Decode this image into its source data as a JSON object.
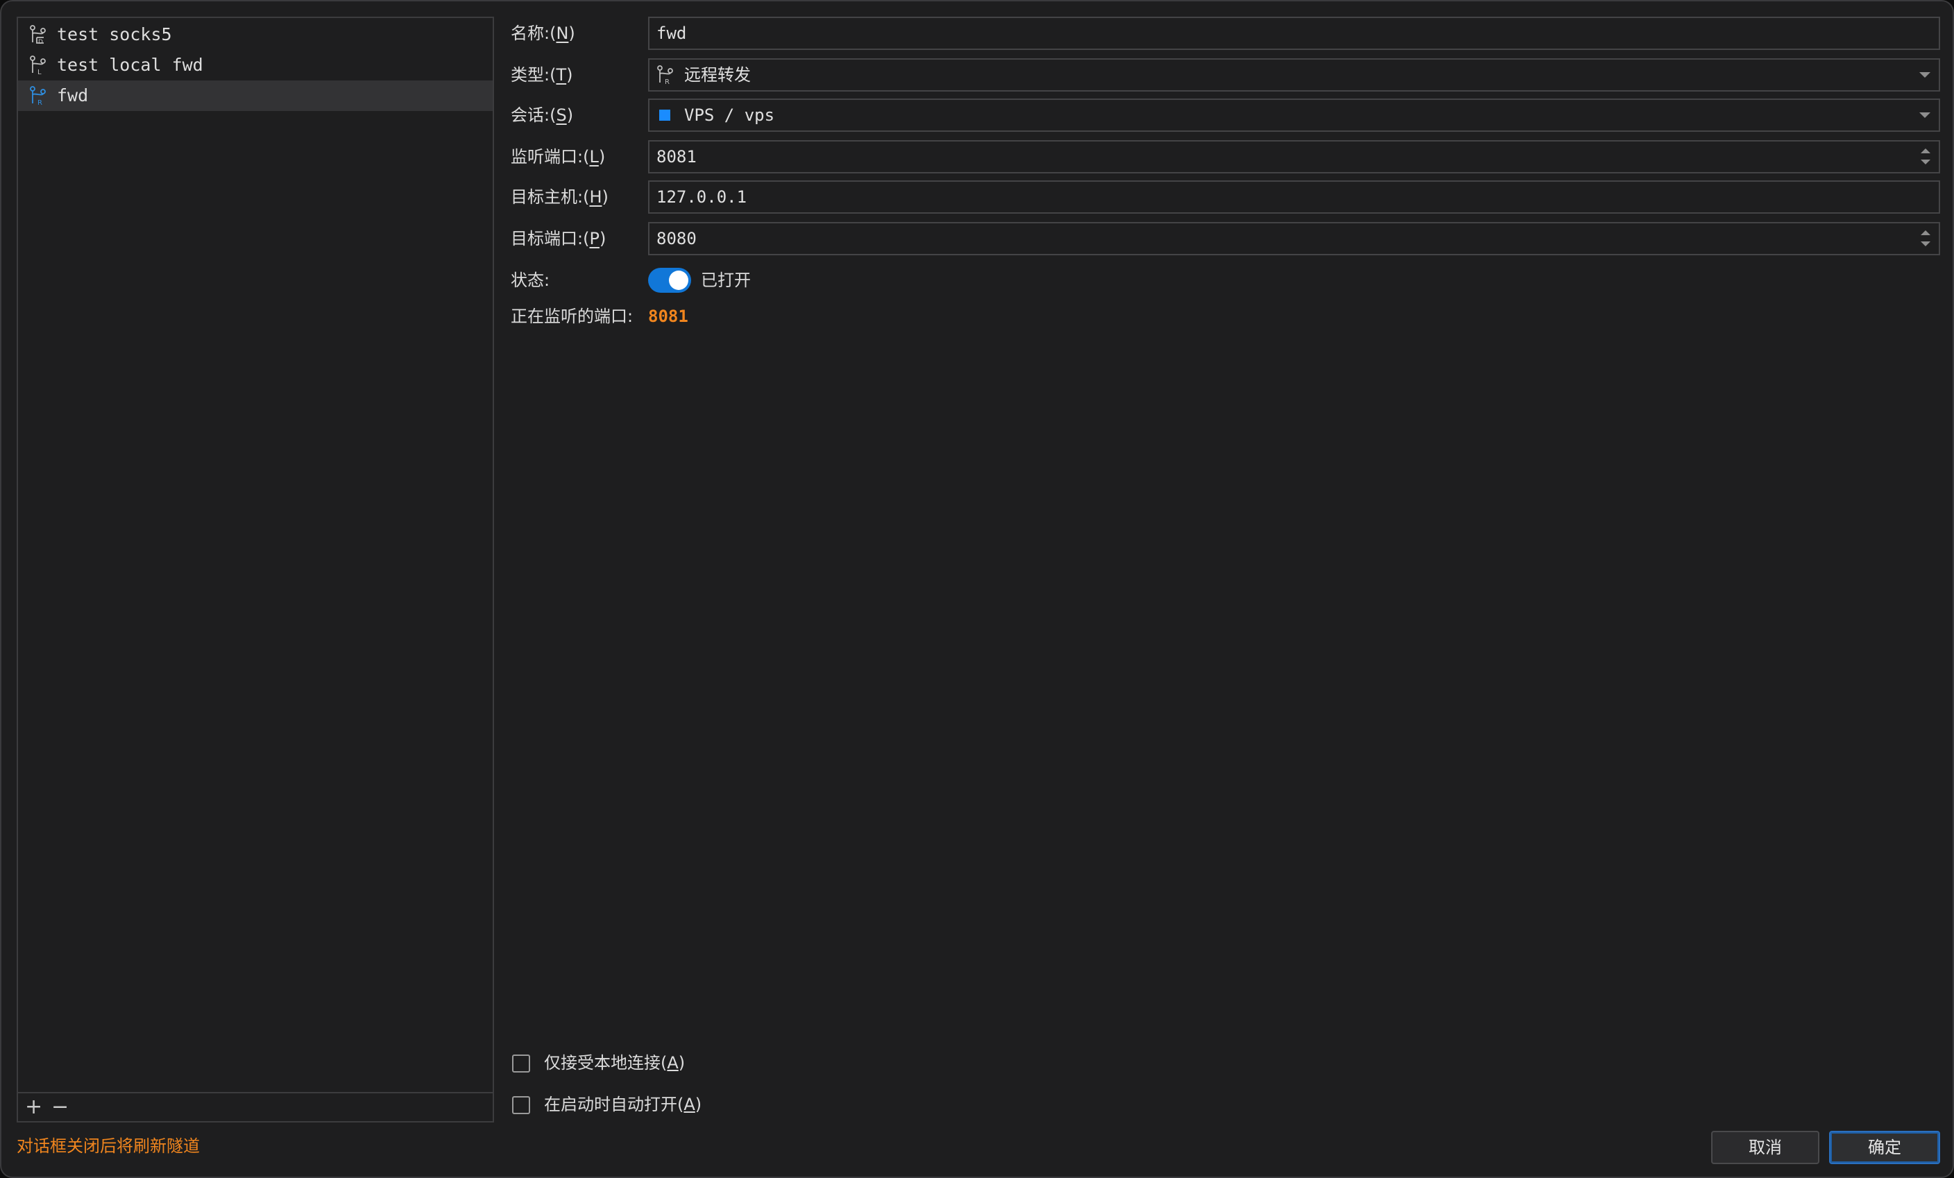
{
  "tunnels": [
    {
      "name": "test socks5",
      "icon": "tunnel-dynamic-icon",
      "selected": false
    },
    {
      "name": "test local fwd",
      "icon": "tunnel-local-icon",
      "selected": false
    },
    {
      "name": "fwd",
      "icon": "tunnel-remote-icon",
      "selected": true
    }
  ],
  "list_footer": {
    "add": "+",
    "remove": "−"
  },
  "form": {
    "name_label": "名称:(",
    "name_key": "N",
    "name_value": "fwd",
    "type_label": "类型:(",
    "type_key": "T",
    "type_value": "远程转发",
    "session_label": "会话:(",
    "session_key": "S",
    "session_value": "VPS / vps",
    "session_color": "#1a8cff",
    "listen_port_label": "监听端口:(",
    "listen_port_key": "L",
    "listen_port_value": "8081",
    "target_host_label": "目标主机:(",
    "target_host_key": "H",
    "target_host_value": "127.0.0.1",
    "target_port_label": "目标端口:(",
    "target_port_key": "P",
    "target_port_value": "8080",
    "status_label": "状态:",
    "status_value": "已打开",
    "status_on": true,
    "listening_label": "正在监听的端口:",
    "listening_value": "8081",
    "close_paren": ")"
  },
  "options": {
    "local_only_label": "仅接受本地连接(",
    "local_only_key": "A",
    "local_only_checked": false,
    "auto_open_label": "在启动时自动打开(",
    "auto_open_key": "A",
    "auto_open_checked": false
  },
  "footer": {
    "notice": "对话框关闭后将刷新隧道",
    "cancel": "取消",
    "ok": "确定"
  },
  "colors": {
    "accent": "#1177d8",
    "warning": "#f0851e",
    "icon_selected": "#2f8ee0",
    "icon_default": "#bdbdbd"
  }
}
